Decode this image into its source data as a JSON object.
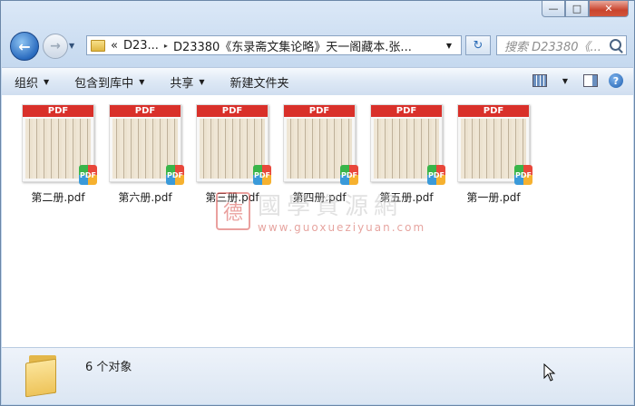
{
  "window": {
    "minimize": "—",
    "maximize": "□",
    "close": "✕"
  },
  "nav": {
    "back": "←",
    "forward": "→",
    "history_dropdown": "▼"
  },
  "address": {
    "chevron": "«",
    "crumb_1": "D23...",
    "separator": "▸",
    "crumb_2": "D23380《东录斋文集论略》天一阁藏本.张...",
    "dropdown": "▼"
  },
  "refresh": "↻",
  "search": {
    "placeholder": "搜索 D23380《..."
  },
  "toolbar": {
    "organize": "组织",
    "include_library": "包含到库中",
    "share": "共享",
    "new_folder": "新建文件夹",
    "dropdown": "▼",
    "help": "?"
  },
  "files": [
    {
      "name": "第二册.pdf",
      "banner": "PDF",
      "badge": "PDF"
    },
    {
      "name": "第六册.pdf",
      "banner": "PDF",
      "badge": "PDF"
    },
    {
      "name": "第三册.pdf",
      "banner": "PDF",
      "badge": "PDF"
    },
    {
      "name": "第四册.pdf",
      "banner": "PDF",
      "badge": "PDF"
    },
    {
      "name": "第五册.pdf",
      "banner": "PDF",
      "badge": "PDF"
    },
    {
      "name": "第一册.pdf",
      "banner": "PDF",
      "badge": "PDF"
    }
  ],
  "watermark": {
    "seal": "德",
    "title": "國學資源網",
    "url": "www.guoxueziyuan.com"
  },
  "status": {
    "count_text": "6 个对象"
  }
}
